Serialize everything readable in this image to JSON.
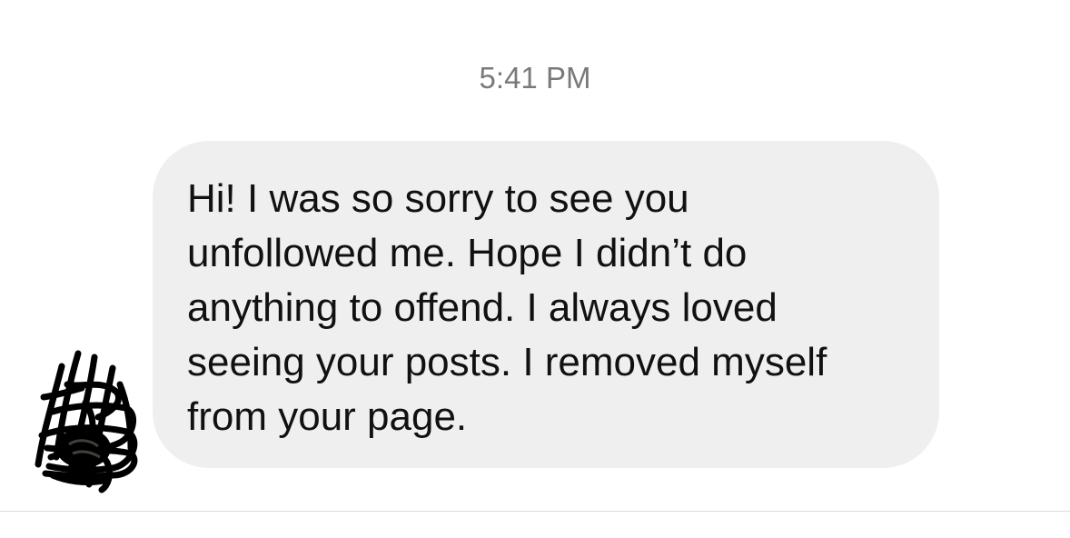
{
  "thread": {
    "timestamp": "5:41 PM",
    "messages": [
      {
        "text": "Hi! I was so sorry to see you\nunfollowed me. Hope I didn’t do\nanything to offend. I always loved\nseeing your posts. I removed myself\nfrom your page.",
        "avatar_icon": "scribbled-out-avatar-icon"
      }
    ]
  },
  "colors": {
    "bubble_background": "#efefef",
    "timestamp_text": "#7a7a7a",
    "message_text": "#111111"
  }
}
